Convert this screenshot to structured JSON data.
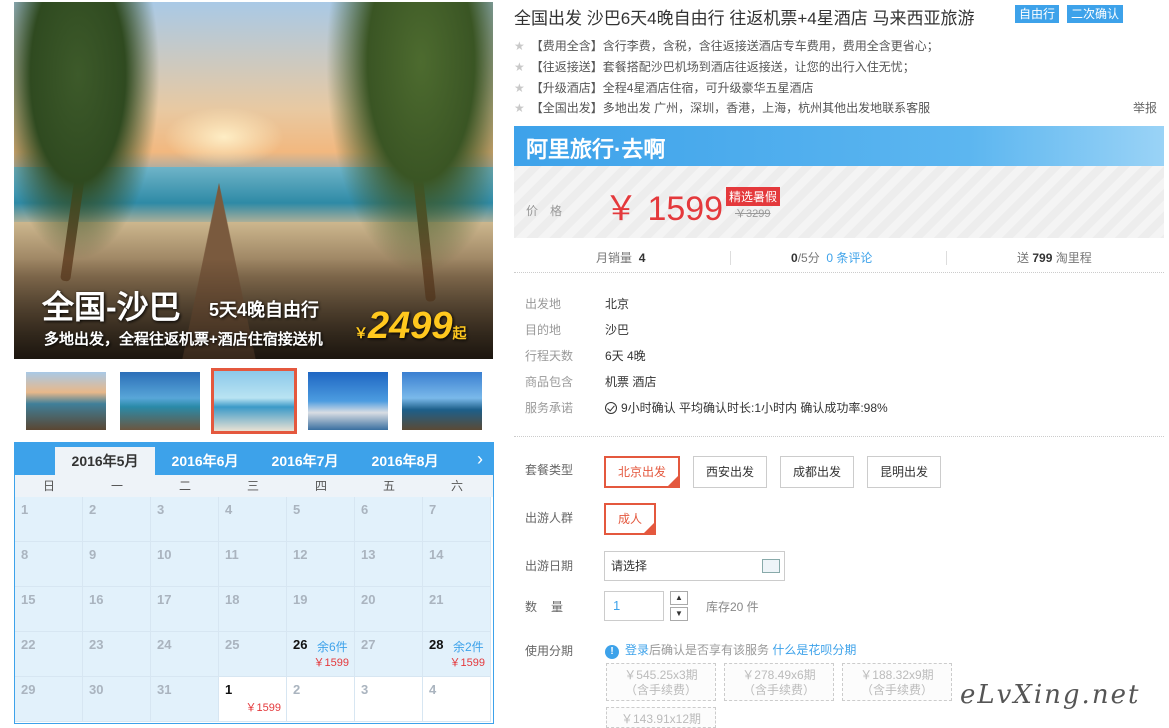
{
  "hero": {
    "title_big": "全国-沙巴",
    "title_small": "5天4晚自由行",
    "subtitle": "多地出发，全程往返机票+酒店住宿接送机",
    "price_yen": "￥",
    "price_num": "2499",
    "price_suffix": "起"
  },
  "product": {
    "title": "全国出发 沙巴6天4晚自由行 往返机票+4星酒店 马来西亚旅游",
    "tags": [
      "自由行",
      "二次确认"
    ],
    "features": [
      "【费用全含】含行李费，含税，含往返接送酒店专车费用，费用全含更省心；",
      "【往返接送】套餐搭配沙巴机场到酒店往返接送，让您的出行入住无忧；",
      "【升级酒店】全程4星酒店住宿，可升级豪华五星酒店",
      "【全国出发】多地出发 广州，深圳，香港，上海，杭州其他出发地联系客服"
    ],
    "report": "举报"
  },
  "price": {
    "brand": "阿里旅行·去啊",
    "label": "价格",
    "current": "￥ 1599",
    "promo_tag": "精选暑假",
    "original": "￥3299"
  },
  "stats": {
    "monthly_sales_label": "月销量",
    "monthly_sales": "4",
    "rating": "0",
    "rating_suffix": "/5分",
    "reviews": "0 条评论",
    "gift_prefix": "送",
    "gift_points": "799",
    "gift_suffix": "淘里程"
  },
  "details": [
    {
      "k": "出发地",
      "v": "北京"
    },
    {
      "k": "目的地",
      "v": "沙巴"
    },
    {
      "k": "行程天数",
      "v": "6天 4晚"
    },
    {
      "k": "商品包含",
      "v": "机票 酒店"
    },
    {
      "k": "服务承诺",
      "v": "9小时确认 平均确认时长:1小时内 确认成功率:98%"
    }
  ],
  "options": {
    "package_label": "套餐类型",
    "packages": [
      "北京出发",
      "西安出发",
      "成都出发",
      "昆明出发"
    ],
    "crowd_label": "出游人群",
    "crowd": "成人",
    "date_label": "出游日期",
    "date_placeholder": "请选择",
    "qty_label": "数量",
    "qty_value": "1",
    "stock": "库存20 件",
    "instal_label": "使用分期",
    "instal_note_blue": "登录",
    "instal_note_gray": "后确认是否享有该服务",
    "instal_link": "什么是花呗分期",
    "instalments": [
      {
        "line1": "￥545.25x3期",
        "line2": "（含手续费）"
      },
      {
        "line1": "￥278.49x6期",
        "line2": "（含手续费）"
      },
      {
        "line1": "￥188.32x9期",
        "line2": "（含手续费）"
      },
      {
        "line1": "￥143.91x12期",
        "line2": ""
      }
    ]
  },
  "calendar": {
    "months": [
      "2016年5月",
      "2016年6月",
      "2016年7月",
      "2016年8月"
    ],
    "weekdays": [
      "日",
      "一",
      "二",
      "三",
      "四",
      "五",
      "六"
    ],
    "next": "›"
  },
  "watermark": "eLvXing.net"
}
